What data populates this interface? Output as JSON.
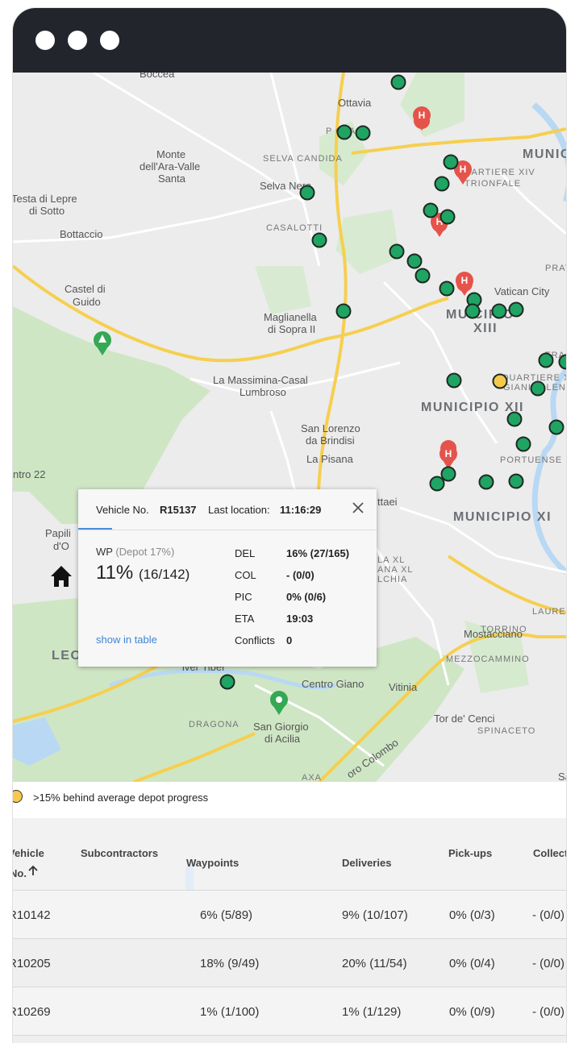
{
  "window": {
    "controls": [
      "window-dot",
      "window-dot",
      "window-dot"
    ]
  },
  "map": {
    "place_labels": [
      "Boccea",
      "Ottavia",
      "Monte",
      "dell'Ara-Valle",
      "Santa",
      "Selva Nera",
      "Testa di Lepre",
      "di Sotto",
      "Bottaccio",
      "Castel di",
      "Guido",
      "Maglianella",
      "di Sopra II",
      "La Massimina-Casal",
      "Lumbroso",
      "San Lorenzo",
      "da Brindisi",
      "La Pisana",
      "Vatican City",
      "Mostacciano",
      "Centro Giano",
      "Vitinia",
      "San Giorgio",
      "di Acilia",
      "Tor de' Cenci",
      "ttaei",
      "Papili",
      "d'O",
      "ntro 22",
      "Sa",
      "oro Colombo",
      "iver Tiber"
    ],
    "area_labels": [
      "SELVA CANDIDA",
      "CASALOTTI",
      "QUARTIERE XIV",
      "TRIONFALE",
      "PORTUENSE",
      "TORRINO",
      "MEZZOCAMMINO",
      "DRAGONA",
      "AXA",
      "SPINACETO",
      "LAUREN",
      "PRAT",
      "TRAS",
      "PA",
      "QUARTIERE XI",
      "GIANICOLENSE",
      "LA XL",
      "ANA XL",
      "LCHIA",
      "P   OLA"
    ],
    "municipio_labels": [
      "MUNICIPIO XII",
      "MUNICIPIO XI",
      "MUNICI",
      "MU   CIPIO",
      "XIII",
      "LEO"
    ]
  },
  "popup": {
    "vehicle_label": "Vehicle No.",
    "vehicle_no": "R15137",
    "last_location_label": "Last location:",
    "last_location_time": "11:16:29",
    "wp_label": "WP",
    "wp_depot": "(Depot 17%)",
    "wp_percent": "11%",
    "wp_count": "(16/142)",
    "show_in_table": "show in table",
    "metrics": [
      {
        "key": "DEL",
        "value": "16% (27/165)"
      },
      {
        "key": "COL",
        "value": "- (0/0)"
      },
      {
        "key": "PIC",
        "value": "0% (0/6)"
      },
      {
        "key": "ETA",
        "value": "19:03"
      },
      {
        "key": "Conflicts",
        "value": "0"
      }
    ]
  },
  "legend": {
    "text": ">15% behind average depot progress",
    "color": "#f7c94b"
  },
  "table": {
    "headers": {
      "vehicle_line1": "Vehicle",
      "vehicle_line2": "No.",
      "sort_icon": "arrow-up-icon",
      "subcontractors": "Subcontractors",
      "waypoints": "Waypoints",
      "deliveries": "Deliveries",
      "pickups": "Pick-ups",
      "collections": "Collect"
    },
    "rows": [
      {
        "vehicle": "R10142",
        "waypoints": "6% (5/89)",
        "wp_progress": 0.06,
        "deliveries": "9% (10/107)",
        "pickups": "0% (0/3)",
        "collections": "- (0/0)"
      },
      {
        "vehicle": "R10205",
        "waypoints": "18% (9/49)",
        "wp_progress": 0.18,
        "deliveries": "20% (11/54)",
        "pickups": "0% (0/4)",
        "collections": "- (0/0)"
      },
      {
        "vehicle": "R10269",
        "waypoints": "1% (1/100)",
        "wp_progress": 0.01,
        "deliveries": "1% (1/129)",
        "pickups": "0% (0/9)",
        "collections": "- (0/0)"
      }
    ]
  },
  "colors": {
    "vehicle_marker": "#1fa463",
    "behind_marker": "#f7c94b",
    "hospital_pin": "#e5534b",
    "park_pin": "#34a853",
    "road_major": "#f6cf4f",
    "green_area": "#cfe6c5",
    "accent": "#4a8fd8"
  }
}
